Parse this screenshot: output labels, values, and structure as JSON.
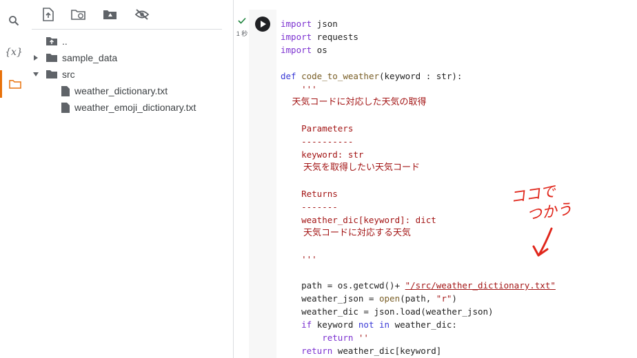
{
  "sidebar": {
    "icons": [
      "search-icon",
      "variables-icon",
      "folder-icon"
    ],
    "variables_label": "{x}"
  },
  "files": {
    "toolbar_icons": [
      "upload-file-icon",
      "refresh-folder-icon",
      "mount-drive-icon",
      "hide-files-icon"
    ],
    "tree": [
      {
        "label": "..",
        "icon": "folder-up-icon"
      },
      {
        "label": "sample_data",
        "icon": "folder-icon",
        "expanded": false
      },
      {
        "label": "src",
        "icon": "folder-icon",
        "expanded": true
      },
      {
        "label": "weather_dictionary.txt",
        "icon": "file-icon"
      },
      {
        "label": "weather_emoji_dictionary.txt",
        "icon": "file-icon"
      }
    ]
  },
  "cell": {
    "status_time": "1 秒",
    "code": {
      "l1_kw": "import",
      "l1_rest": " json",
      "l2_kw": "import",
      "l2_rest": " requests",
      "l3_kw": "import",
      "l3_rest": " os",
      "l5_def": "def",
      "l5_fn": "code_to_weather",
      "l5_rest": "(keyword : str):",
      "l6": "    '''",
      "l7": "    天気コードに対応した天気の取得",
      "l9": "    Parameters",
      "l10": "    ----------",
      "l11": "    keyword: str",
      "l12": "        天気を取得したい天気コード",
      "l14": "    Returns",
      "l15": "    -------",
      "l16": "    weather_dic[keyword]: dict",
      "l17": "        天気コードに対応する天気",
      "l19": "    '''",
      "l21_a": "    path = os.getcwd()+ ",
      "l21_str": "\"/src/weather_dictionary.txt\"",
      "l22_a": "    weather_json = ",
      "l22_fn": "open",
      "l22_b": "(path, ",
      "l22_str": "\"r\"",
      "l22_c": ")",
      "l23": "    weather_dic = json.load(weather_json)",
      "l24_if": "if",
      "l24_a": " keyword ",
      "l24_not": "not",
      "l24_in": "in",
      "l24_b": " weather_dic:",
      "l25_ret": "return",
      "l25_str": " ''",
      "l26_ret": "return",
      "l26_rest": " weather_dic[keyword]"
    }
  },
  "annotation": {
    "line1": "ココで",
    "line2": "つかう",
    "color": "#e0261b"
  },
  "colors": {
    "accent": "#e8710a",
    "keyword": "#7b30d0",
    "docstring": "#a31515"
  }
}
